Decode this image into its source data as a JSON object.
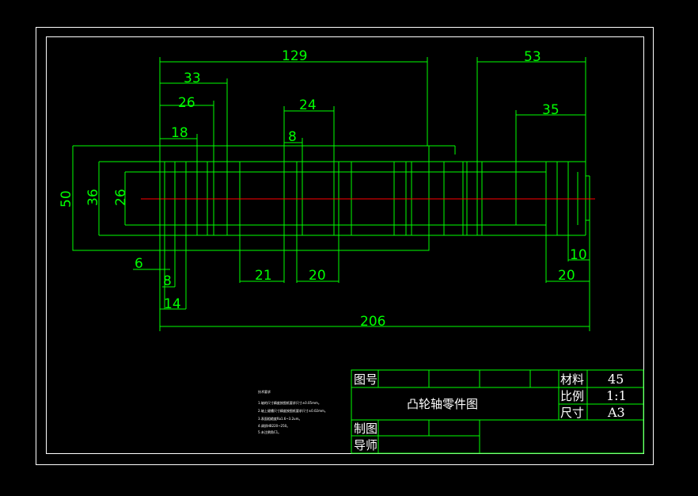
{
  "dimensions": {
    "d129": "129",
    "d33": "33",
    "d26": "26",
    "d18": "18",
    "d24": "24",
    "d8top": "8",
    "d53": "53",
    "d35": "35",
    "v50": "50",
    "v36": "36",
    "v26": "26",
    "d6": "6",
    "d8": "8",
    "d14": "14",
    "d21": "21",
    "d20a": "20",
    "d10": "10",
    "d20b": "20",
    "d206": "206"
  },
  "title_block": {
    "drawing_no_label": "图号",
    "title": "凸轮轴零件图",
    "material_label": "材料",
    "material_value": "45",
    "scale_label": "比例",
    "scale_value": "1:1",
    "size_label": "尺寸",
    "size_value": "A3",
    "drafter_label": "制图",
    "instructor_label": "导师"
  },
  "technical_notes": {
    "heading": "技术要求",
    "items": [
      "1.轴的尺寸精度按图纸要求尺寸±0.05mm。",
      "2.轴上键槽尺寸精度按图纸要求尺寸±0.02mm。",
      "3.表面粗糙度Ra1.6~3.2um。",
      "4.调质HB220~250。",
      "5.未注倒角C1。"
    ]
  },
  "colors": {
    "background": "#000000",
    "lines": "#00ff00",
    "frame": "#ffffff",
    "centerline": "#ff0000"
  }
}
